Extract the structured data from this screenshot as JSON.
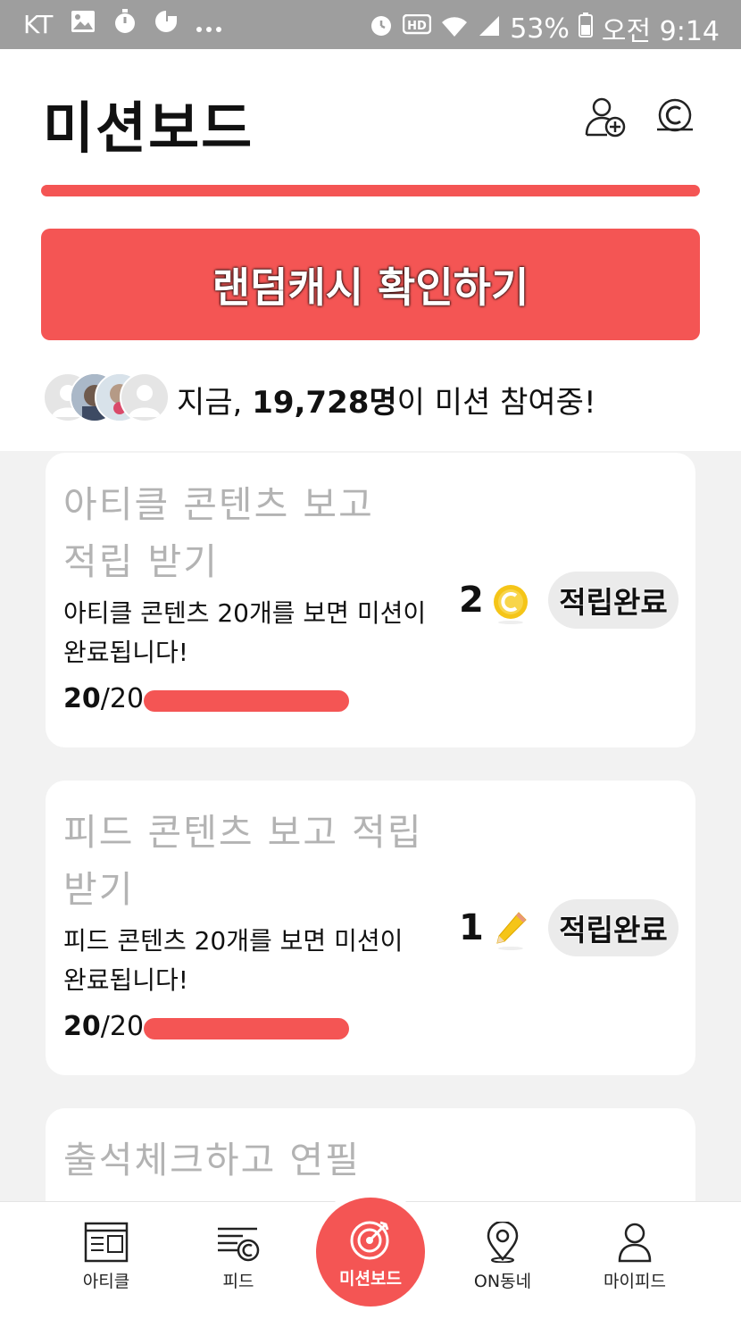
{
  "status_bar": {
    "carrier": "KT",
    "notif_icons": [
      "image-icon",
      "stopwatch-icon",
      "game-icon",
      "more-dots-icon"
    ],
    "sys_icons": [
      "alarm-icon",
      "hd-icon",
      "wifi-icon",
      "signal-icon",
      "battery-icon"
    ],
    "battery": "53%",
    "time": "오전 9:14"
  },
  "header": {
    "title": "미션보드",
    "icons": [
      "add-friend-icon",
      "cash-icon"
    ]
  },
  "random_cash_button": "랜덤캐시 확인하기",
  "participants": {
    "prefix": "지금, ",
    "count": "19,728명",
    "suffix": "이 미션 참여중!"
  },
  "missions": [
    {
      "title_line1": "아티클 콘텐츠 보고",
      "title_line2": "적립 받기",
      "desc_line1": "아티클 콘텐츠 20개를 보면 미션이",
      "desc_line2": "완료됩니다!",
      "progress_current": "20",
      "progress_total": "/20",
      "progress_ratio": 1.0,
      "reward_amount": "2",
      "reward_icon": "coin-icon",
      "status_label": "적립완료"
    },
    {
      "title_line1": "피드 콘텐츠 보고 적립",
      "title_line2": "받기",
      "desc_line1": "피드 콘텐츠 20개를 보면 미션이",
      "desc_line2": "완료됩니다!",
      "progress_current": "20",
      "progress_total": "/20",
      "progress_ratio": 1.0,
      "reward_amount": "1",
      "reward_icon": "pencil-icon",
      "status_label": "적립완료"
    },
    {
      "title_line1": "출석체크하고 연필"
    }
  ],
  "bottom_nav": {
    "items": [
      {
        "label": "아티클",
        "icon": "article-icon"
      },
      {
        "label": "피드",
        "icon": "feed-icon"
      },
      {
        "label": "미션보드",
        "icon": "target-icon",
        "active": true
      },
      {
        "label": "ON동네",
        "icon": "location-pin-icon"
      },
      {
        "label": "마이피드",
        "icon": "person-icon"
      }
    ]
  },
  "colors": {
    "accent": "#f45554",
    "status_bar": "#9e9e9e",
    "card_title": "#b3b3b3",
    "pill_bg": "#ebebeb",
    "coin": "#f5c518"
  }
}
